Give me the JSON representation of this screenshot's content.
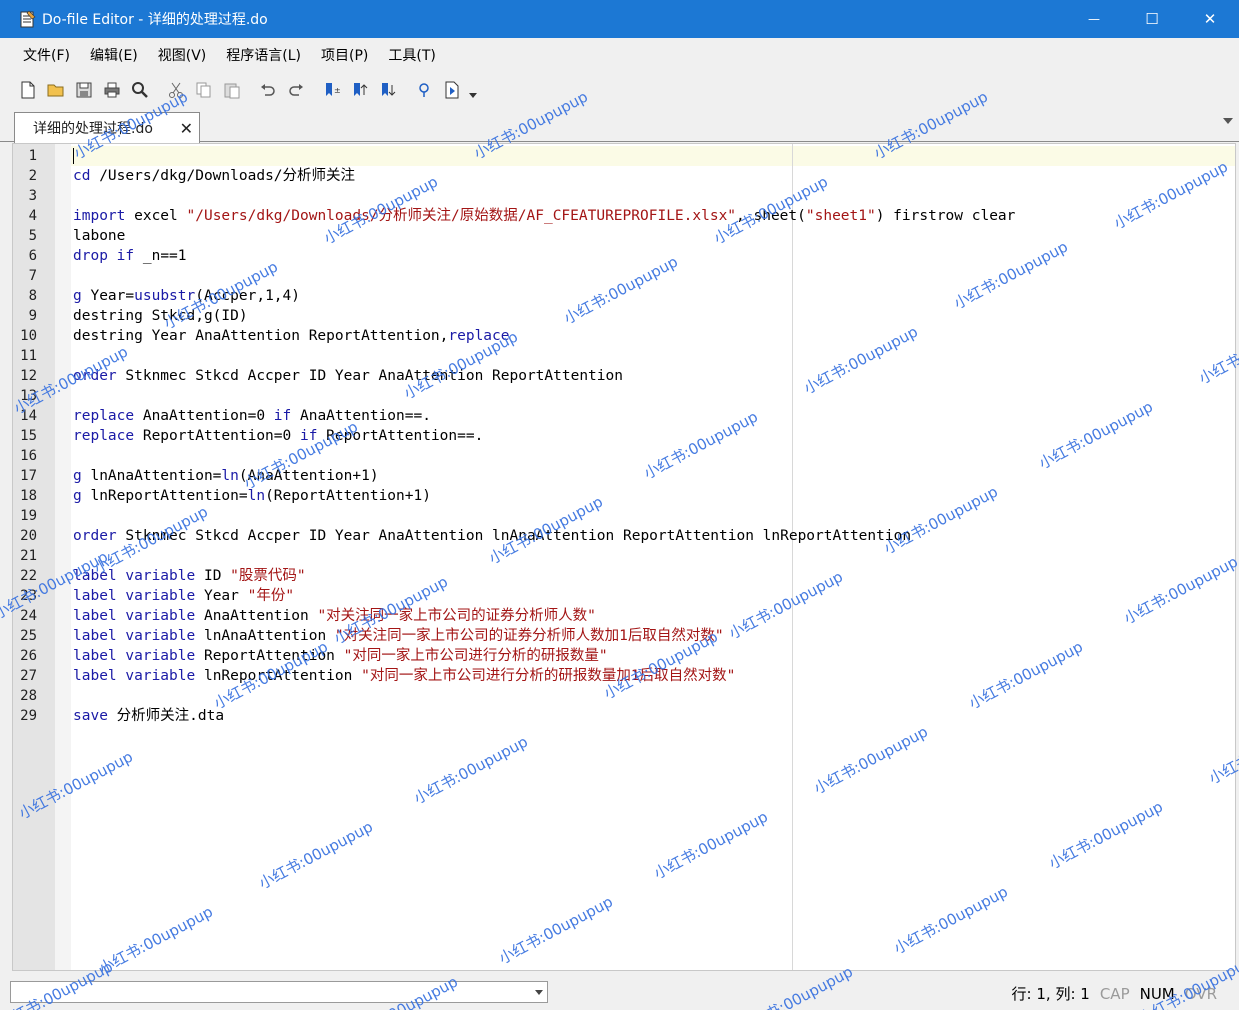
{
  "window": {
    "title": "Do-file Editor - 详细的处理过程.do",
    "controls": {
      "minimize": "—",
      "maximize": "☐",
      "close": "✕"
    }
  },
  "menu": [
    "文件(F)",
    "编辑(E)",
    "视图(V)",
    "程序语言(L)",
    "项目(P)",
    "工具(T)"
  ],
  "toolbar": {
    "icons": [
      "new-file-icon",
      "open-folder-icon",
      "save-icon",
      "print-icon",
      "find-icon",
      "cut-icon",
      "copy-icon",
      "paste-icon",
      "undo-icon",
      "redo-icon",
      "toggle-bookmark-icon",
      "previous-bookmark-icon",
      "next-bookmark-icon",
      "show-variables-icon",
      "execute-icon"
    ]
  },
  "tab": {
    "label": "详细的处理过程.do",
    "close": "✕"
  },
  "code_lines": [
    {
      "n": "1",
      "html": ""
    },
    {
      "n": "2",
      "html": "<span class='kw'>cd</span> /Users/dkg/Downloads/分析师关注"
    },
    {
      "n": "3",
      "html": ""
    },
    {
      "n": "4",
      "html": "<span class='kw'>import</span> excel <span class='str'>\"/Users/dkg/Downloads/分析师关注/原始数据/AF_CFEATUREPROFILE.xlsx\"</span>, sheet(<span class='str'>\"sheet1\"</span>) firstrow clear"
    },
    {
      "n": "5",
      "html": "labone"
    },
    {
      "n": "6",
      "html": "<span class='kw'>drop</span> <span class='kw'>if</span> _n==1"
    },
    {
      "n": "7",
      "html": ""
    },
    {
      "n": "8",
      "html": "<span class='kw'>g</span> Year=<span class='kw'>usubstr</span>(Accper,1,4)"
    },
    {
      "n": "9",
      "html": "destring Stkcd,g(ID)"
    },
    {
      "n": "10",
      "html": "destring Year AnaAttention ReportAttention,<span class='kw'>replace</span>"
    },
    {
      "n": "11",
      "html": ""
    },
    {
      "n": "12",
      "html": "<span class='kw'>order</span> Stknmec Stkcd Accper ID Year AnaAttention ReportAttention"
    },
    {
      "n": "13",
      "html": ""
    },
    {
      "n": "14",
      "html": "<span class='kw'>replace</span> AnaAttention=0 <span class='kw'>if</span> AnaAttention==."
    },
    {
      "n": "15",
      "html": "<span class='kw'>replace</span> ReportAttention=0 <span class='kw'>if</span> ReportAttention==."
    },
    {
      "n": "16",
      "html": ""
    },
    {
      "n": "17",
      "html": "<span class='kw'>g</span> lnAnaAttention=<span class='kw'>ln</span>(AnaAttention+1)"
    },
    {
      "n": "18",
      "html": "<span class='kw'>g</span> lnReportAttention=<span class='kw'>ln</span>(ReportAttention+1)"
    },
    {
      "n": "19",
      "html": ""
    },
    {
      "n": "20",
      "html": "<span class='kw'>order</span> Stknmec Stkcd Accper ID Year AnaAttention lnAnaAttention ReportAttention lnReportAttention"
    },
    {
      "n": "21",
      "html": ""
    },
    {
      "n": "22",
      "html": "<span class='kw'>label</span> <span class='kw'>variable</span> ID <span class='str'>\"股票代码\"</span>"
    },
    {
      "n": "23",
      "html": "<span class='kw'>label</span> <span class='kw'>variable</span> Year <span class='str'>\"年份\"</span>"
    },
    {
      "n": "24",
      "html": "<span class='kw'>label</span> <span class='kw'>variable</span> AnaAttention <span class='str'>\"对关注同一家上市公司的证券分析师人数\"</span>"
    },
    {
      "n": "25",
      "html": "<span class='kw'>label</span> <span class='kw'>variable</span> lnAnaAttention <span class='str'>\"对关注同一家上市公司的证券分析师人数加1后取自然对数\"</span>"
    },
    {
      "n": "26",
      "html": "<span class='kw'>label</span> <span class='kw'>variable</span> ReportAttention <span class='str'>\"对同一家上市公司进行分析的研报数量\"</span>"
    },
    {
      "n": "27",
      "html": "<span class='kw'>label</span> <span class='kw'>variable</span> lnReportAttention <span class='str'>\"对同一家上市公司进行分析的研报数量加1后取自然对数\"</span>"
    },
    {
      "n": "28",
      "html": ""
    },
    {
      "n": "29",
      "html": "<span class='kw'>save</span> 分析师关注.dta"
    }
  ],
  "status": {
    "position": "行: 1, 列: 1",
    "cap": "CAP",
    "num": "NUM",
    "ovr": "OVR"
  },
  "watermark": "小红书:00upupup"
}
